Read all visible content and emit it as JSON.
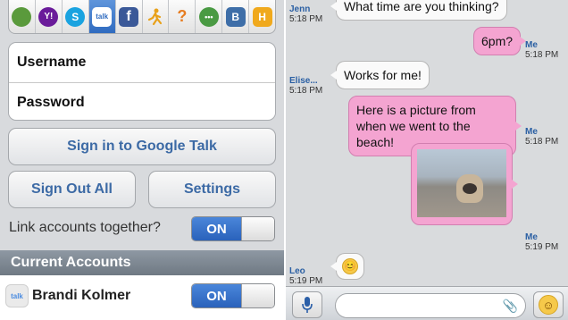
{
  "login": {
    "services": [
      {
        "icon": "aim-buddy-icon",
        "color": "#5a9a3c",
        "glyph": ""
      },
      {
        "icon": "yahoo-icon",
        "color": "#6a1b9a",
        "glyph": "Y!"
      },
      {
        "icon": "skype-icon",
        "color": "#1aa3e0",
        "glyph": "S"
      },
      {
        "icon": "google-talk-icon",
        "color": "#4a8be0",
        "glyph": "talk"
      },
      {
        "icon": "facebook-icon",
        "color": "#3b5998",
        "glyph": "f"
      },
      {
        "icon": "aim-running-man-icon",
        "color": "#e8a11a",
        "glyph": ""
      },
      {
        "icon": "icq-icon",
        "color": "#e67d22",
        "glyph": "?"
      },
      {
        "icon": "chat-bubble-icon",
        "color": "#4a9a43",
        "glyph": "•••"
      },
      {
        "icon": "bebo-icon",
        "color": "#3e6ea8",
        "glyph": "B"
      },
      {
        "icon": "hyves-icon",
        "color": "#f0a91d",
        "glyph": "H"
      }
    ],
    "username_label": "Username",
    "password_label": "Password",
    "signin_label": "Sign in to Google Talk",
    "signout_label": "Sign Out All",
    "settings_label": "Settings",
    "link_label": "Link accounts together?",
    "link_toggle": "ON",
    "section_title": "Current Accounts",
    "account_name": "Brandi Kolmer",
    "account_toggle": "ON"
  },
  "chat": {
    "messages": [
      {
        "sender": "Jenn",
        "time": "5:18 PM",
        "text": "What time are you thinking?"
      },
      {
        "sender": "Me",
        "time": "5:18 PM",
        "text": "6pm?"
      },
      {
        "sender": "Elise...",
        "time": "5:18 PM",
        "text": "Works for me!"
      },
      {
        "sender": "Me",
        "time": "5:18 PM",
        "text": "Here is a picture from when we went to the beach!"
      },
      {
        "sender": "Me",
        "time": "5:19 PM",
        "text": ""
      },
      {
        "sender": "Leo",
        "time": "5:19 PM",
        "text": "😊"
      }
    ]
  }
}
